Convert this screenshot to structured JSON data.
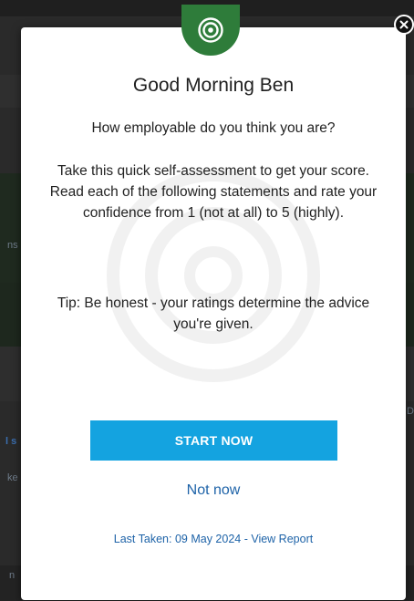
{
  "background": {
    "fragments": [
      "ns",
      "l s",
      "ke",
      "D",
      "n"
    ]
  },
  "modal": {
    "greeting": "Good Morning Ben",
    "question": "How employable do you think you are?",
    "description_lines": [
      "Take this quick self-assessment to get your score.",
      "Read each of the following statements and rate your confidence from 1 (not at all) to 5 (highly)."
    ],
    "tip": "Tip: Be honest - your ratings determine the advice you're given.",
    "start_label": "START NOW",
    "not_now_label": "Not now",
    "last_taken_prefix": "Last Taken: 09 May 2024 - ",
    "view_report_label": "View Report",
    "icons": {
      "badge": "target-icon",
      "close": "close-icon",
      "watermark": "target-watermark-icon"
    }
  },
  "colors": {
    "brand_green": "#2e7c3a",
    "button_blue": "#14a3e0",
    "link_blue": "#1e63a8"
  }
}
